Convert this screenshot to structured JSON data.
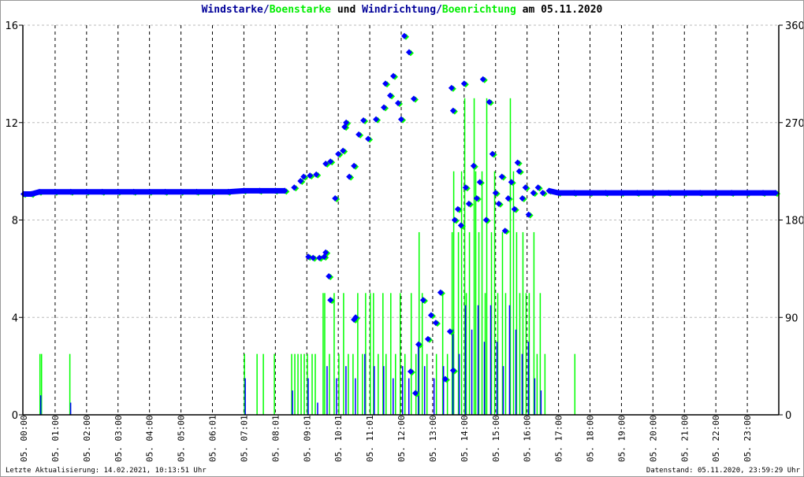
{
  "colors": {
    "speed": "#0000ff",
    "gust": "#00ff00",
    "title_blue": "#000099",
    "grid": "#bbbbbb"
  },
  "title_parts": [
    {
      "text": "Windstarke",
      "color": "#000099"
    },
    {
      "text": "/",
      "color": "#000099"
    },
    {
      "text": "Boenstarke",
      "color": "#00ee00"
    },
    {
      "text": " und ",
      "color": "#000000"
    },
    {
      "text": "Windrichtung",
      "color": "#000099"
    },
    {
      "text": "/",
      "color": "#000099"
    },
    {
      "text": "Boenrichtung",
      "color": "#00ee00"
    },
    {
      "text": " am 05.11.2020",
      "color": "#000000"
    }
  ],
  "footer": {
    "left": "Letzte Aktualisierung: 14.02.2021, 10:13:51 Uhr",
    "right": "Datenstand: 05.11.2020, 23:59:29 Uhr"
  },
  "chart_data": {
    "type": "bar+scatter",
    "title": "Windstarke/Boenstarke und Windrichtung/Boenrichtung am 05.11.2020",
    "x_range_hours": [
      0,
      24
    ],
    "x_tick_labels": [
      "05. 00:00",
      "05. 01:00",
      "05. 02:00",
      "05. 03:00",
      "05. 04:00",
      "05. 05:00",
      "05. 06:01",
      "05. 07:01",
      "05. 08:01",
      "05. 09:01",
      "05. 10:01",
      "05. 11:01",
      "05. 12:00",
      "05. 13:00",
      "05. 14:00",
      "05. 15:00",
      "05. 16:00",
      "05. 17:00",
      "05. 18:00",
      "05. 19:00",
      "05. 20:00",
      "05. 21:00",
      "05. 22:00",
      "05. 23:00"
    ],
    "y_left": {
      "range": [
        0,
        16
      ],
      "ticks": [
        "0",
        "4",
        "8",
        "12",
        "16"
      ]
    },
    "y_right": {
      "range": [
        0,
        360
      ],
      "ticks": [
        "0",
        "90",
        "180",
        "270",
        "360"
      ]
    },
    "grid": true,
    "gust": [
      [
        0.5,
        2.5
      ],
      [
        0.55,
        2.5
      ],
      [
        1.45,
        2.5
      ],
      [
        7.0,
        2.5
      ],
      [
        7.4,
        2.5
      ],
      [
        7.6,
        2.5
      ],
      [
        7.95,
        2.5
      ],
      [
        8.5,
        2.5
      ],
      [
        8.6,
        2.5
      ],
      [
        8.7,
        2.5
      ],
      [
        8.8,
        2.5
      ],
      [
        8.9,
        2.5
      ],
      [
        9.0,
        2.5
      ],
      [
        9.15,
        2.5
      ],
      [
        9.25,
        2.5
      ],
      [
        9.5,
        5
      ],
      [
        9.55,
        5
      ],
      [
        9.7,
        2.5
      ],
      [
        9.85,
        5
      ],
      [
        10.0,
        2.5
      ],
      [
        10.15,
        5
      ],
      [
        10.3,
        2.5
      ],
      [
        10.45,
        2.5
      ],
      [
        10.6,
        5
      ],
      [
        10.75,
        2.5
      ],
      [
        10.85,
        5
      ],
      [
        11.0,
        5
      ],
      [
        11.1,
        5
      ],
      [
        11.25,
        2.5
      ],
      [
        11.4,
        5
      ],
      [
        11.5,
        2.5
      ],
      [
        11.65,
        5
      ],
      [
        11.8,
        2.5
      ],
      [
        11.95,
        5
      ],
      [
        12.1,
        2.5
      ],
      [
        12.3,
        5
      ],
      [
        12.45,
        2.5
      ],
      [
        12.55,
        7.5
      ],
      [
        12.65,
        5
      ],
      [
        12.8,
        2.5
      ],
      [
        13.1,
        2.5
      ],
      [
        13.3,
        5
      ],
      [
        13.45,
        2.5
      ],
      [
        13.6,
        7.5
      ],
      [
        13.65,
        10
      ],
      [
        13.8,
        7.5
      ],
      [
        13.9,
        10
      ],
      [
        14.0,
        13
      ],
      [
        14.05,
        5
      ],
      [
        14.15,
        7.5
      ],
      [
        14.3,
        13
      ],
      [
        14.35,
        10
      ],
      [
        14.45,
        7.5
      ],
      [
        14.55,
        10
      ],
      [
        14.65,
        5
      ],
      [
        14.7,
        13
      ],
      [
        14.85,
        7.5
      ],
      [
        14.95,
        10
      ],
      [
        15.05,
        5
      ],
      [
        15.2,
        7.5
      ],
      [
        15.3,
        5
      ],
      [
        15.45,
        13
      ],
      [
        15.55,
        10
      ],
      [
        15.65,
        7.5
      ],
      [
        15.75,
        5
      ],
      [
        15.85,
        7.5
      ],
      [
        15.95,
        5
      ],
      [
        16.05,
        5
      ],
      [
        16.2,
        7.5
      ],
      [
        16.3,
        2.5
      ],
      [
        16.4,
        5
      ],
      [
        16.55,
        2.5
      ],
      [
        17.5,
        2.5
      ]
    ],
    "speed": [
      [
        0.5,
        0.8
      ],
      [
        1.45,
        0.5
      ],
      [
        7.0,
        1.5
      ],
      [
        8.5,
        1
      ],
      [
        9.0,
        1.5
      ],
      [
        9.3,
        0.5
      ],
      [
        9.6,
        2
      ],
      [
        9.9,
        1.5
      ],
      [
        10.2,
        2
      ],
      [
        10.5,
        1.5
      ],
      [
        10.8,
        2.5
      ],
      [
        11.1,
        2
      ],
      [
        11.4,
        2
      ],
      [
        11.7,
        1.5
      ],
      [
        12.0,
        2
      ],
      [
        12.2,
        1.5
      ],
      [
        12.5,
        3
      ],
      [
        12.7,
        2
      ],
      [
        13.0,
        1.5
      ],
      [
        13.3,
        2
      ],
      [
        13.6,
        3.5
      ],
      [
        13.8,
        2.5
      ],
      [
        14.0,
        4.5
      ],
      [
        14.2,
        3.5
      ],
      [
        14.4,
        4.5
      ],
      [
        14.6,
        3
      ],
      [
        14.8,
        4.5
      ],
      [
        15.0,
        3
      ],
      [
        15.2,
        2
      ],
      [
        15.4,
        4.5
      ],
      [
        15.6,
        3.5
      ],
      [
        15.8,
        2.5
      ],
      [
        16.0,
        3
      ],
      [
        16.2,
        1.5
      ],
      [
        16.4,
        1
      ]
    ],
    "direction": [
      [
        0,
        204
      ],
      [
        0.25,
        204
      ],
      [
        0.5,
        206
      ],
      [
        1,
        206
      ],
      [
        1.5,
        206
      ],
      [
        2,
        206
      ],
      [
        2.5,
        206
      ],
      [
        3,
        206
      ],
      [
        3.5,
        206
      ],
      [
        4,
        206
      ],
      [
        4.5,
        206
      ],
      [
        5,
        206
      ],
      [
        5.5,
        206
      ],
      [
        6,
        206
      ],
      [
        6.5,
        206
      ],
      [
        7,
        207
      ],
      [
        7.5,
        207
      ],
      [
        8,
        207
      ],
      [
        8.3,
        207
      ],
      [
        8.6,
        210
      ],
      [
        8.8,
        216
      ],
      [
        8.9,
        220
      ],
      [
        9.1,
        221
      ],
      [
        9.3,
        222
      ],
      [
        9.05,
        146
      ],
      [
        9.2,
        145
      ],
      [
        9.4,
        145
      ],
      [
        9.55,
        146
      ],
      [
        9.6,
        150
      ],
      [
        9.7,
        128
      ],
      [
        9.75,
        106
      ],
      [
        9.6,
        232
      ],
      [
        9.75,
        234
      ],
      [
        9.9,
        200
      ],
      [
        10.0,
        241
      ],
      [
        10.15,
        244
      ],
      [
        10.2,
        266
      ],
      [
        10.25,
        270
      ],
      [
        10.35,
        220
      ],
      [
        10.5,
        230
      ],
      [
        10.5,
        88
      ],
      [
        10.55,
        90
      ],
      [
        10.65,
        259
      ],
      [
        10.8,
        272
      ],
      [
        10.95,
        255
      ],
      [
        11.2,
        273
      ],
      [
        11.45,
        284
      ],
      [
        11.5,
        306
      ],
      [
        11.65,
        295
      ],
      [
        11.75,
        313
      ],
      [
        11.9,
        288
      ],
      [
        12.0,
        273
      ],
      [
        12.1,
        350
      ],
      [
        12.25,
        335
      ],
      [
        12.4,
        292
      ],
      [
        12.3,
        40
      ],
      [
        12.45,
        20
      ],
      [
        12.55,
        65
      ],
      [
        12.7,
        106
      ],
      [
        12.85,
        70
      ],
      [
        12.95,
        92
      ],
      [
        13.1,
        85
      ],
      [
        13.25,
        113
      ],
      [
        13.4,
        33
      ],
      [
        13.55,
        77
      ],
      [
        13.65,
        41
      ],
      [
        13.6,
        302
      ],
      [
        13.65,
        281
      ],
      [
        13.7,
        180
      ],
      [
        13.8,
        190
      ],
      [
        13.9,
        175
      ],
      [
        14.0,
        306
      ],
      [
        14.05,
        210
      ],
      [
        14.15,
        195
      ],
      [
        14.3,
        230
      ],
      [
        14.4,
        200
      ],
      [
        14.5,
        215
      ],
      [
        14.6,
        310
      ],
      [
        14.7,
        180
      ],
      [
        14.8,
        289
      ],
      [
        14.9,
        241
      ],
      [
        15.0,
        205
      ],
      [
        15.1,
        195
      ],
      [
        15.2,
        220
      ],
      [
        15.3,
        170
      ],
      [
        15.4,
        200
      ],
      [
        15.5,
        215
      ],
      [
        15.6,
        190
      ],
      [
        15.7,
        233
      ],
      [
        15.75,
        225
      ],
      [
        15.85,
        200
      ],
      [
        15.95,
        210
      ],
      [
        16.05,
        185
      ],
      [
        16.2,
        205
      ],
      [
        16.35,
        210
      ],
      [
        16.5,
        205
      ],
      [
        16.7,
        207
      ],
      [
        17,
        205
      ],
      [
        17.5,
        205
      ],
      [
        18,
        205
      ],
      [
        18.5,
        205
      ],
      [
        19,
        205
      ],
      [
        19.5,
        205
      ],
      [
        20,
        205
      ],
      [
        20.5,
        205
      ],
      [
        21,
        205
      ],
      [
        21.5,
        205
      ],
      [
        22,
        205
      ],
      [
        22.5,
        205
      ],
      [
        23,
        205
      ],
      [
        23.5,
        205
      ],
      [
        23.9,
        205
      ]
    ]
  }
}
